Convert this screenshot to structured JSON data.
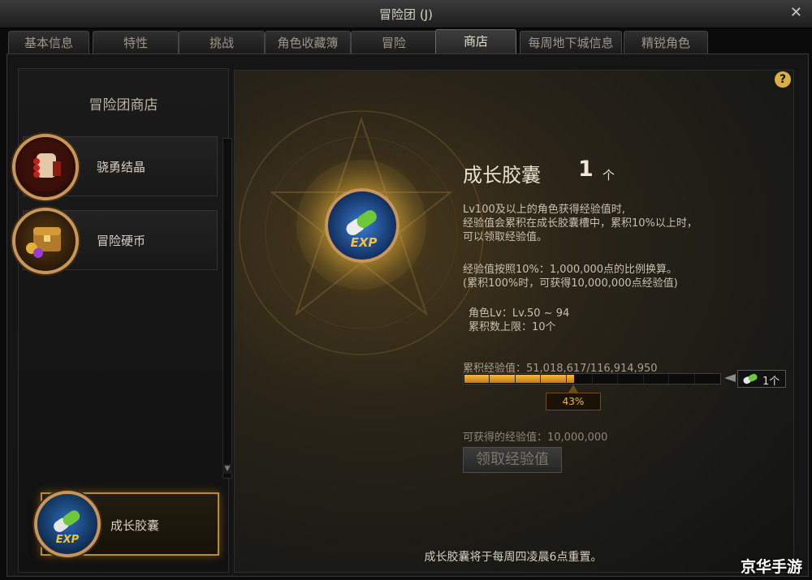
{
  "window": {
    "title": "冒险团 (J)",
    "close_label": "✕"
  },
  "tabs": [
    {
      "label": "基本信息",
      "active": false
    },
    {
      "label": "特性",
      "active": false
    },
    {
      "label": "挑战",
      "active": false
    },
    {
      "label": "角色收藏簿",
      "active": false
    },
    {
      "label": "冒险",
      "active": false
    },
    {
      "label": "商店",
      "active": true
    },
    {
      "label": "每周地下城信息",
      "active": false
    },
    {
      "label": "精锐角色",
      "active": false
    }
  ],
  "sidebar": {
    "heading": "冒险团商店",
    "items": [
      {
        "label": "骁勇结晶",
        "icon": "crystal-fist-icon"
      },
      {
        "label": "冒险硬币",
        "icon": "treasure-chest-icon"
      }
    ],
    "selected_item": {
      "label": "成长胶囊",
      "icon": "exp-capsule-icon"
    },
    "scroll_up": "▲",
    "scroll_down": "▼"
  },
  "product": {
    "title": "成长胶囊",
    "count": "1",
    "unit": "个",
    "description_1": "Lv100及以上的角色获得经验值时,\n经验值会累积在成长胶囊槽中，累积10%以上时，\n可以领取经验值。",
    "description_2": "经验值按照10%：1,000,000点的比例换算。\n(累积100%时，可获得10,000,000点经验值)",
    "description_3": "角色Lv：Lv.50 ~ 94\n累积数上限：10个",
    "accumulated_label": "累积经验值：51,018,617/116,914,950",
    "progress_fraction": 0.43,
    "progress_percent_label": "43%",
    "capsule_count_label": "1个",
    "obtainable_label": "可获得的经验值：10,000,000",
    "claim_button": "领取经验值"
  },
  "help_icon": "?",
  "footer_note": "成长胶囊将于每周四凌晨6点重置。",
  "watermark": "京华手游",
  "colors": {
    "accent_gold": "#c9965a",
    "progress": "#f5b93a",
    "capsule_green": "#6ec83a"
  }
}
